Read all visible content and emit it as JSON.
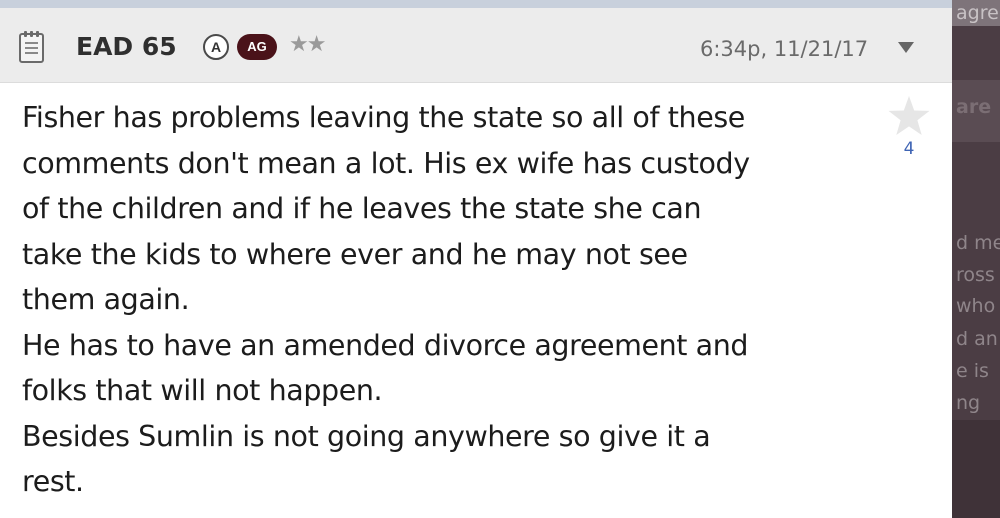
{
  "post": {
    "username": "EAD 65",
    "badges": {
      "a": "A",
      "ag": "AG"
    },
    "rating_stars": "★★",
    "timestamp": "6:34p, 11/21/17",
    "icons": {
      "post": "notepad-icon",
      "menu": "chevron-down-icon",
      "like": "star-icon"
    },
    "like_count": "4",
    "body_lines": [
      "Fisher has problems leaving the state so all of these",
      "comments don't mean a lot. His ex wife has custody",
      "of the children and if he leaves the state she can",
      "take the kids to where ever and he may not see",
      "them again.",
      "He has to have an amended divorce agreement and",
      "folks that will not happen.",
      "Besides Sumlin is not going anywhere so give it a",
      "rest."
    ]
  },
  "background_fragments": [
    "agre",
    "are",
    "d me",
    "ross",
    "who",
    "d an",
    "e is",
    "ng"
  ],
  "colors": {
    "header_bg": "#ececec",
    "ag_badge": "#4a1219",
    "like_count": "#3f64b4",
    "side_panel": "#4b3d44"
  }
}
